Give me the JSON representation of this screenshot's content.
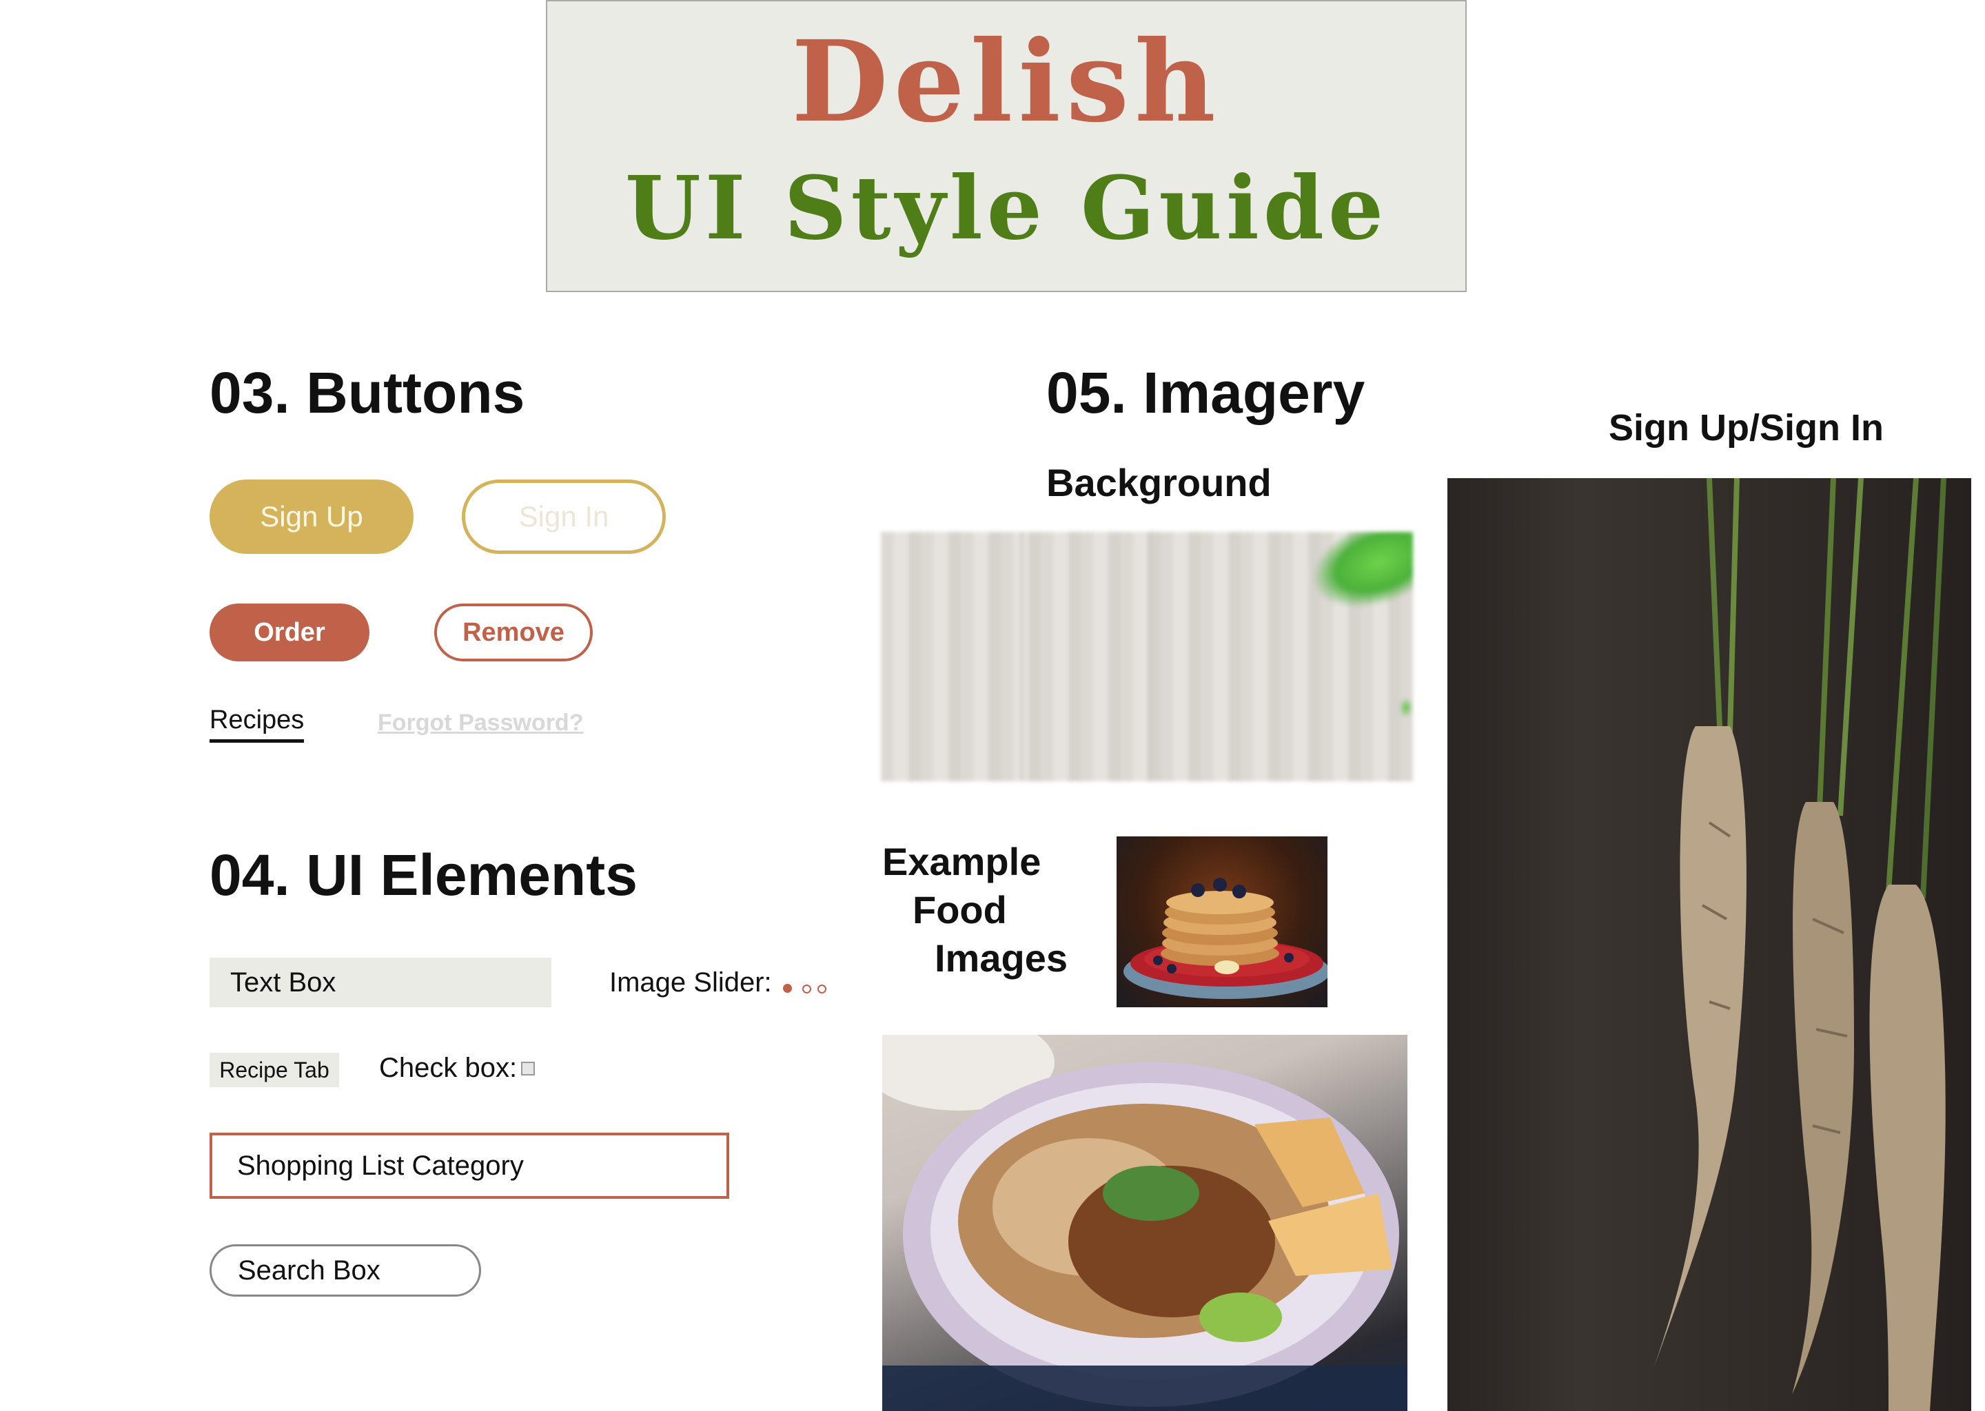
{
  "header": {
    "brand": "Delish",
    "subtitle": "UI Style Guide"
  },
  "buttons_section": {
    "title": "03. Buttons",
    "sign_up": "Sign Up",
    "sign_in": "Sign In",
    "order": "Order",
    "remove": "Remove",
    "recipes_link": "Recipes",
    "forgot_password_link": "Forgot Password?"
  },
  "ui_elements_section": {
    "title": "04. UI Elements",
    "text_box": "Text Box",
    "image_slider_label": "Image Slider:",
    "image_slider_active_index": 0,
    "image_slider_count": 3,
    "recipe_tab": "Recipe Tab",
    "check_box_label": "Check box:",
    "shopping_list_category": "Shopping List Category",
    "search_box": "Search Box"
  },
  "imagery_section": {
    "title": "05. Imagery",
    "background_label": "Background",
    "example_food_images_label": [
      "Example",
      "Food",
      "Images"
    ],
    "sign_up_sign_in_label": "Sign Up/Sign In"
  },
  "colors": {
    "brand_terracotta": "#c0614a",
    "brand_green": "#4f7d18",
    "gold": "#d4b35a",
    "banner_bg": "#ebebe6",
    "field_gray": "#ebebe6"
  },
  "icons": {
    "checkbox": "checkbox-icon",
    "slider_dots": "slider-dot-icon"
  }
}
